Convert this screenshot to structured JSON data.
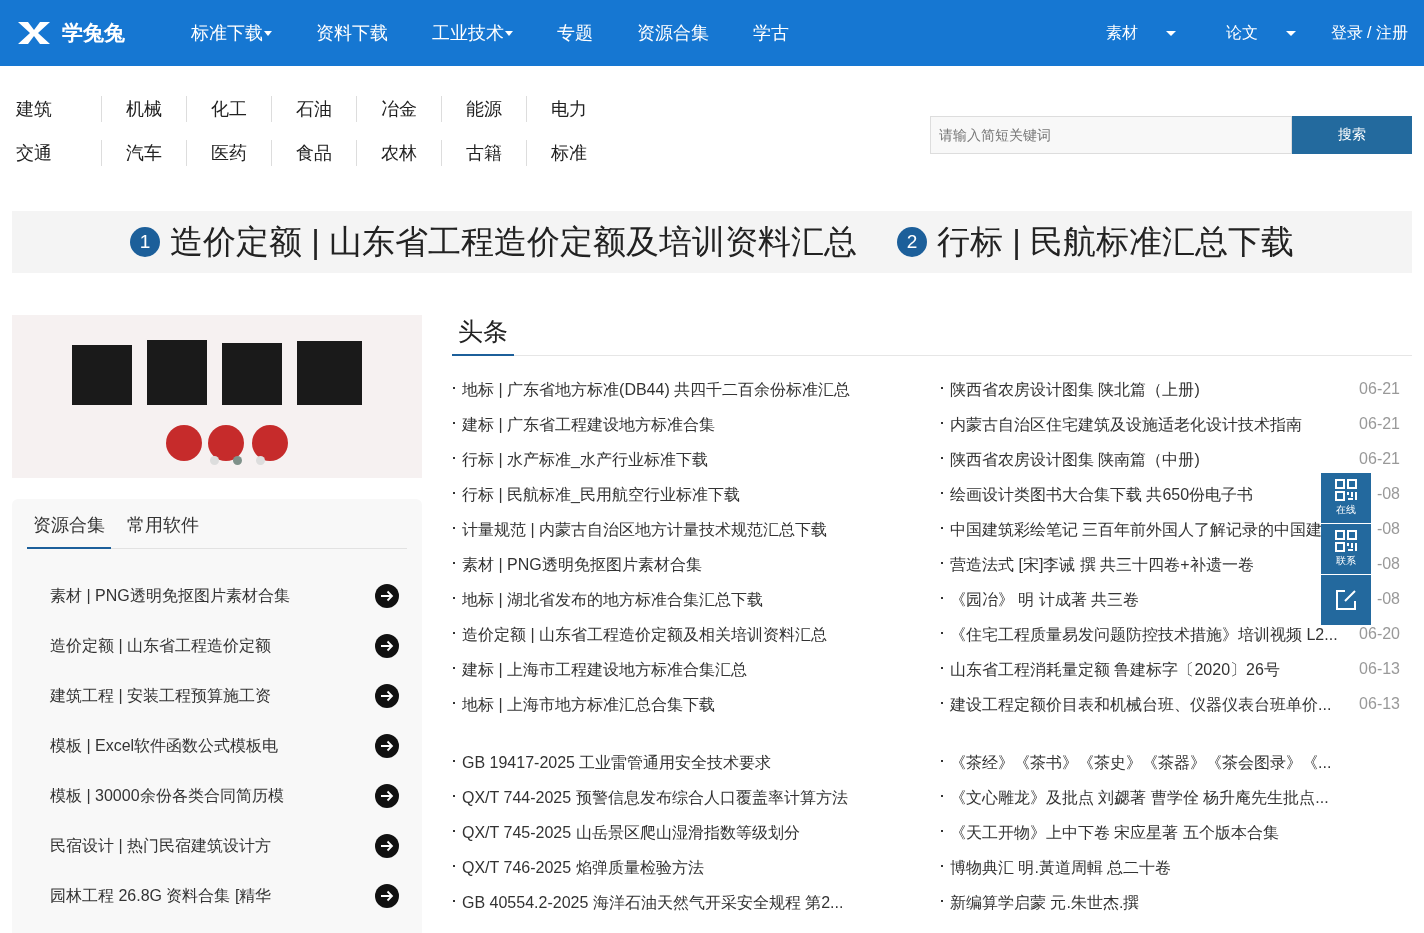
{
  "header": {
    "logo_text": "学兔兔",
    "nav": [
      {
        "label": "标准下载",
        "dropdown": true
      },
      {
        "label": "资料下载",
        "dropdown": false
      },
      {
        "label": "工业技术",
        "dropdown": true
      },
      {
        "label": "专题",
        "dropdown": false
      },
      {
        "label": "资源合集",
        "dropdown": false
      },
      {
        "label": "学古",
        "dropdown": false
      }
    ],
    "right_menu": [
      {
        "label": "素材",
        "dropdown": true
      },
      {
        "label": "论文",
        "dropdown": true
      }
    ],
    "login": "登录 / 注册"
  },
  "categories": [
    [
      "建筑",
      "机械",
      "化工",
      "石油",
      "冶金",
      "能源",
      "电力"
    ],
    [
      "交通",
      "汽车",
      "医药",
      "食品",
      "农林",
      "古籍",
      "标准"
    ]
  ],
  "search": {
    "placeholder": "请输入简短关键词",
    "button": "搜索"
  },
  "headlines": [
    {
      "number": "1",
      "text": "造价定额 | 山东省工程造价定额及培训资料汇总"
    },
    {
      "number": "2",
      "text": "行标 | 民航标准汇总下载"
    }
  ],
  "banner": {
    "kind": "picture",
    "dots": [
      {
        "selected": false
      },
      {
        "selected": true
      },
      {
        "selected": false
      }
    ]
  },
  "side_tabs": [
    {
      "label": "资源合集",
      "selected": true
    },
    {
      "label": "常用软件",
      "selected": false
    }
  ],
  "side_list": [
    "素材 | PNG透明免抠图片素材合集",
    "造价定额 | 山东省工程造价定额",
    "建筑工程 | 安装工程预算施工资",
    "模板 | Excel软件函数公式模板电",
    "模板 | 30000余份各类合同简历模",
    "民宿设计 | 热门民宿建筑设计方",
    "园林工程 26.8G 资料合集 [精华"
  ],
  "news": {
    "title": "头条",
    "left_items": [
      "地标 | 广东省地方标准(DB44) 共四千二百余份标准汇总",
      "建标 | 广东省工程建设地方标准合集",
      "行标 | 水产标准_水产行业标准下载",
      "行标 | 民航标准_民用航空行业标准下载",
      "计量规范 | 内蒙古自治区地方计量技术规范汇总下载",
      "素材 | PNG透明免抠图片素材合集",
      "地标 | 湖北省发布的地方标准合集汇总下载",
      "造价定额 | 山东省工程造价定额及相关培训资料汇总",
      "建标 | 上海市工程建设地方标准合集汇总",
      "地标 | 上海市地方标准汇总合集下载"
    ],
    "right_items": [
      {
        "text": "陕西省农房设计图集 陕北篇（上册)",
        "date": "06-21"
      },
      {
        "text": "内蒙古自治区住宅建筑及设施适老化设计技术指南",
        "date": "06-21"
      },
      {
        "text": "陕西省农房设计图集 陕南篇（中册)",
        "date": "06-21"
      },
      {
        "text": "绘画设计类图书大合集下载 共650份电子书",
        "date": "-08"
      },
      {
        "text": "中国建筑彩绘笔记 三百年前外国人了解记录的中国建",
        "date": "-08"
      },
      {
        "text": "营造法式 [宋]李诫 撰 共三十四卷+补遗一卷",
        "date": "-08"
      },
      {
        "text": "《园冶》 明 计成著 共三卷",
        "date": "-08"
      },
      {
        "text": "《住宅工程质量易发问题防控技术措施》培训视频 L2...",
        "date": "06-20"
      },
      {
        "text": "山东省工程消耗量定额 鲁建标字〔2020〕26号",
        "date": "06-13"
      },
      {
        "text": "建设工程定额价目表和机械台班、仪器仪表台班单价...",
        "date": "06-13"
      }
    ]
  },
  "standards": {
    "left_items": [
      "GB 19417-2025 工业雷管通用安全技术要求",
      "QX/T 744-2025 预警信息发布综合人口覆盖率计算方法",
      "QX/T 745-2025 山岳景区爬山湿滑指数等级划分",
      "QX/T 746-2025 焰弹质量检验方法",
      "GB 40554.2-2025 海洋石油天然气开采安全规程 第2..."
    ],
    "right_items": [
      "《茶经》《茶书》《茶史》《茶器》《茶会图录》《...",
      "《文心雕龙》及批点 刘勰著 曹学佺 杨升庵先生批点...",
      "《天工开物》上中下卷 宋应星著 五个版本合集",
      "博物典汇 明.黃道周輯 总二十卷",
      "新编算学启蒙 元.朱世杰.撰"
    ]
  },
  "float_buttons": [
    {
      "kind": "qr",
      "label": "在线"
    },
    {
      "kind": "qr",
      "label": "联系"
    },
    {
      "kind": "edit"
    }
  ]
}
